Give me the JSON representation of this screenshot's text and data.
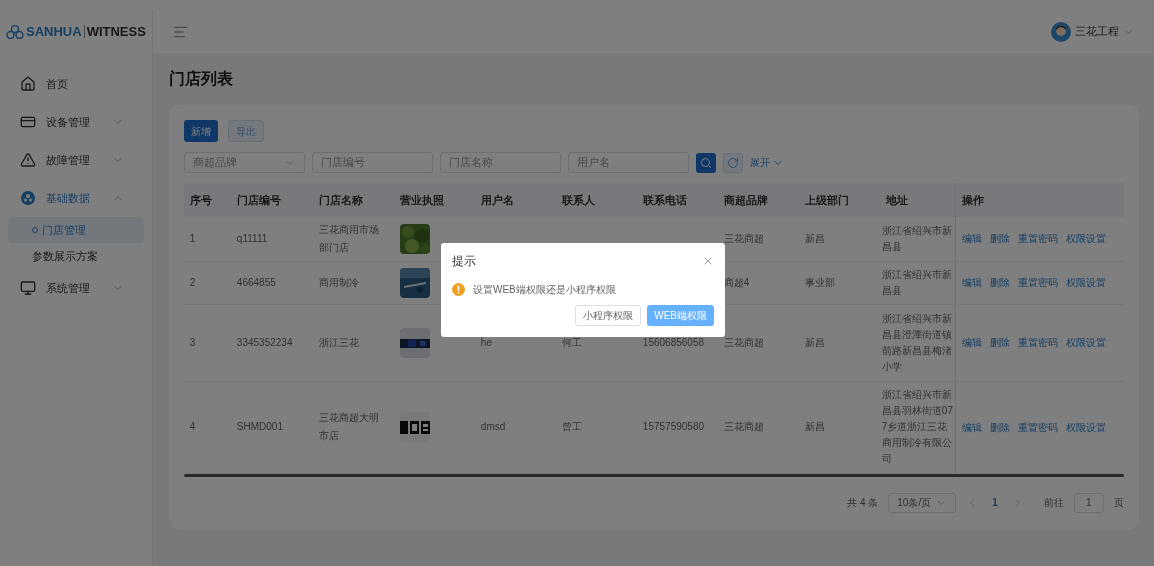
{
  "logo": {
    "brand": "SANHUA",
    "product": "WITNESS"
  },
  "sidebar": {
    "items": [
      {
        "label": "首页",
        "kind": "home",
        "selected": false
      },
      {
        "label": "设备管理",
        "kind": "device",
        "selected": false,
        "expanded": false
      },
      {
        "label": "故障管理",
        "kind": "fault",
        "selected": false,
        "expanded": false
      },
      {
        "label": "基础数据",
        "kind": "data",
        "selected": true,
        "expanded": true,
        "children": [
          {
            "label": "门店管理",
            "selected": true
          },
          {
            "label": "参数展示方案",
            "selected": false
          }
        ]
      },
      {
        "label": "系统管理",
        "kind": "system",
        "selected": false,
        "expanded": false
      }
    ]
  },
  "header": {
    "user": "三花工程"
  },
  "page_title": "门店列表",
  "toolbar": [
    {
      "label": "新增",
      "kind": "primary"
    },
    {
      "label": "导出",
      "kind": "plain"
    }
  ],
  "filters": [
    {
      "kind": "select",
      "placeholder": "商超品牌"
    },
    {
      "kind": "input",
      "placeholder": "门店编号"
    },
    {
      "kind": "input",
      "placeholder": "门店名称"
    },
    {
      "kind": "input",
      "placeholder": "用户名"
    }
  ],
  "expand_link": "展开",
  "table": {
    "columns": [
      "序号",
      "门店编号",
      "门店名称",
      "营业执照",
      "用户名",
      "联系人",
      "联系电话",
      "商超品牌",
      "上级部门",
      "地址",
      "操作"
    ],
    "rows": [
      {
        "index": "1",
        "code": "q11111",
        "name": "三花商用市场部门店",
        "license": {
          "kind": "picture"
        },
        "brand": "三花商超",
        "department": "新昌",
        "address": "浙江省绍兴市新昌县",
        "actions": [
          "编辑",
          "删除",
          "重置密码",
          "权限设置"
        ]
      },
      {
        "index": "2",
        "code": "4664855",
        "name": "商用制冷",
        "license": {
          "kind": "picture"
        },
        "brand": "商超4",
        "department": "事业部",
        "address": "浙江省绍兴市新昌县",
        "actions": [
          "编辑",
          "删除",
          "重置密码",
          "权限设置"
        ]
      },
      {
        "index": "3",
        "code": "3345352234",
        "name": "浙江三花",
        "license": {
          "kind": "picture"
        },
        "user": "he",
        "contact": "何工",
        "phone": "15606856058",
        "brand": "三花商超",
        "department": "新昌",
        "address": "浙江省绍兴市新昌县澄潭街道镇前路新昌县梅渚小学",
        "actions": [
          "编辑",
          "删除",
          "重置密码",
          "权限设置"
        ]
      },
      {
        "index": "4",
        "code": "SHMD001",
        "name": "三花商超大明市店",
        "license": {
          "kind": "picture"
        },
        "user": "dmsd",
        "contact": "曾工",
        "phone": "15757590580",
        "brand": "三花商超",
        "department": "新昌",
        "address": "浙江省绍兴市新昌县羽林街道077乡道浙江三花商用制冷有限公司",
        "actions": [
          "编辑",
          "删除",
          "重置密码",
          "权限设置"
        ]
      }
    ]
  },
  "pagination": {
    "total": "共 4 条",
    "page_size": "10条/页",
    "pages": [
      {
        "label": "1",
        "selected": true
      }
    ],
    "goto_label": "前往",
    "goto_value": "1",
    "goto_suffix": "页"
  },
  "dialog": {
    "title": "提示",
    "message": "设置WEB端权限还是小程序权限",
    "buttons": [
      {
        "label": "小程序权限",
        "kind": "plain"
      },
      {
        "label": "WEB端权限",
        "kind": "primary"
      }
    ]
  }
}
